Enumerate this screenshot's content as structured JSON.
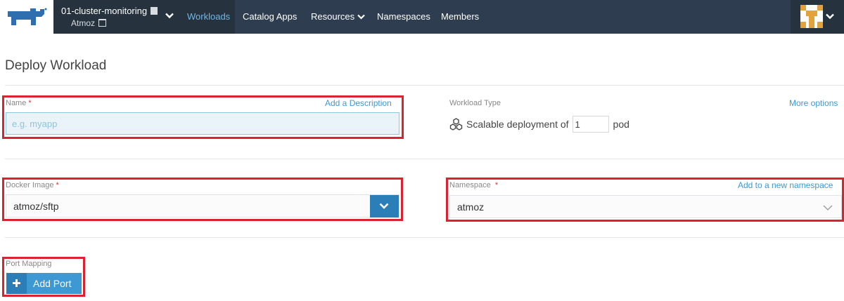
{
  "header": {
    "cluster_name": "01-cluster-monitoring",
    "project_name": "Atmoz",
    "nav": [
      {
        "label": "Workloads",
        "active": true
      },
      {
        "label": "Catalog Apps"
      },
      {
        "label": "Resources"
      },
      {
        "label": "Namespaces"
      },
      {
        "label": "Members"
      }
    ],
    "icons": {
      "logo": "rancher-cow-logo-icon",
      "cluster": "document-icon",
      "project": "window-icon",
      "avatar": "user-avatar"
    }
  },
  "page": {
    "title": "Deploy Workload"
  },
  "form": {
    "name_label": "Name",
    "required_mark": "*",
    "add_description": "Add a Description",
    "name_placeholder": "e.g. myapp",
    "workload_type_label": "Workload Type",
    "more_options": "More options",
    "scale_prefix": "Scalable deployment of",
    "scale_value": "1",
    "scale_suffix": "pod",
    "docker_image_label": "Docker Image",
    "docker_image_value": "atmoz/sftp",
    "namespace_label": "Namespace",
    "add_namespace": "Add to a new namespace",
    "namespace_value": "atmoz",
    "port_mapping_label": "Port Mapping",
    "add_port_label": "Add Port"
  },
  "colors": {
    "header_bg": "#2e3e50",
    "accent": "#3d98d3",
    "highlight": "#d9232e"
  }
}
